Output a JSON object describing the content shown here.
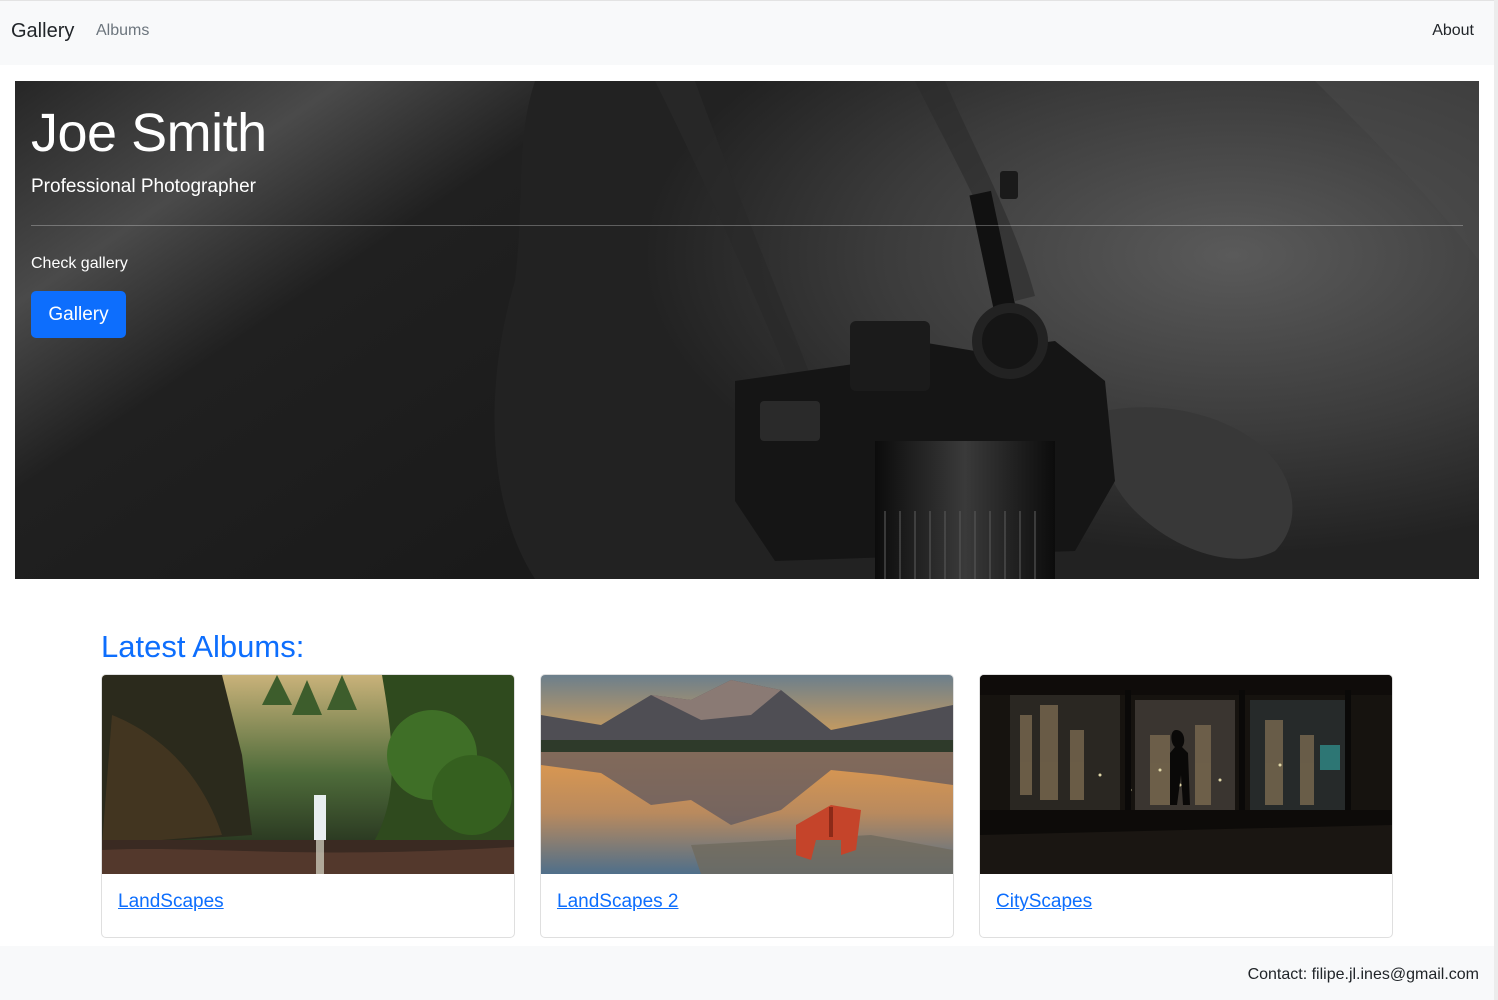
{
  "navbar": {
    "brand": "Gallery",
    "links": [
      {
        "label": "Albums"
      },
      {
        "label": "About"
      }
    ]
  },
  "hero": {
    "title": "Joe Smith",
    "subtitle": "Professional Photographer",
    "lead": "Check gallery",
    "button_label": "Gallery"
  },
  "albums": {
    "heading": "Latest Albums:",
    "items": [
      {
        "title": "LandScapes"
      },
      {
        "title": "LandScapes 2"
      },
      {
        "title": "CityScapes"
      }
    ]
  },
  "footer": {
    "contact": "Contact: filipe.jl.ines@gmail.com"
  },
  "colors": {
    "accent": "#0d6efd",
    "nav_background": "#f8f9fa",
    "text": "#212529",
    "muted": "#6c757d"
  }
}
